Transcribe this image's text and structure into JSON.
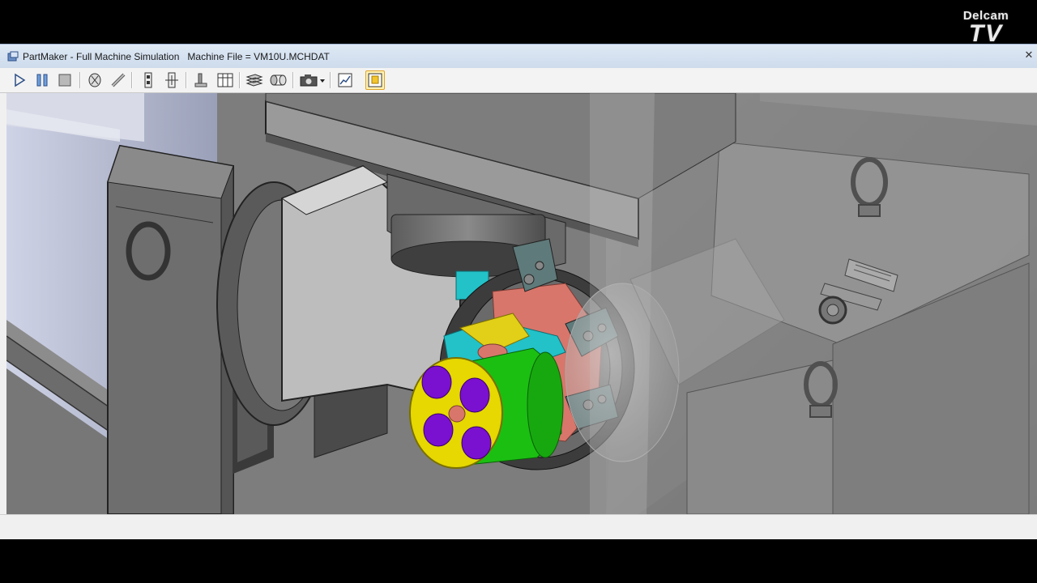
{
  "window": {
    "title": "PartMaker - Full Machine Simulation   Machine File = VM10U.MCHDAT",
    "close_glyph": "✕"
  },
  "watermark": {
    "line1": "Delcam",
    "line2": "TV"
  },
  "toolbar": {
    "buttons": [
      {
        "name": "play-icon"
      },
      {
        "name": "pause-icon"
      },
      {
        "name": "stop-icon"
      },
      {
        "name": "part-view-icon"
      },
      {
        "name": "measure-icon"
      },
      {
        "name": "step-icon"
      },
      {
        "name": "tool-holder-icon"
      },
      {
        "name": "tool-icon"
      },
      {
        "name": "table-icon"
      },
      {
        "name": "stock-layers-icon"
      },
      {
        "name": "cylinder-stock-icon"
      },
      {
        "name": "camera-icon"
      },
      {
        "name": "report-icon"
      },
      {
        "name": "highlight-icon"
      }
    ],
    "active_button": "highlight-icon"
  },
  "colors": {
    "accent": "#e0a42a",
    "machine_body": "#7a7a7a",
    "part_yellow": "#e6d800",
    "part_green": "#1bbf12",
    "part_purple": "#7a10d0",
    "fixture_cyan": "#22c2c8",
    "chuck_red": "#d8766b"
  }
}
